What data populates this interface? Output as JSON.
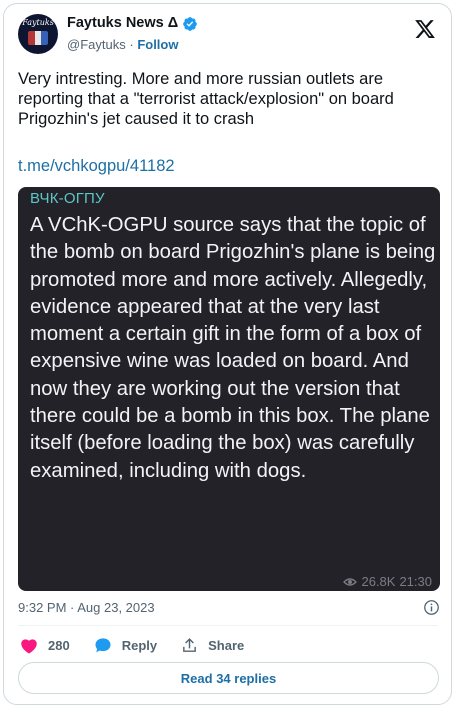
{
  "author": {
    "display_name": "Faytuks News Δ",
    "handle": "@Faytuks",
    "separator": "·",
    "follow_label": "Follow",
    "avatar_text": "Faytuks",
    "verified_icon": "verified-badge-icon"
  },
  "tweet": {
    "text": "Very intresting. More and more russian outlets are reporting that a \"terrorist attack/explosion\" on board Prigozhin's jet caused it to crash",
    "link": "t.me/vchkogpu/41182",
    "timestamp": "9:32 PM · Aug 23, 2023"
  },
  "embed": {
    "channel": "ВЧК-ОГПУ",
    "body": "A VChK-OGPU source says that the topic of the bomb on board Prigozhin's plane is being promoted more and more actively. Allegedly, evidence appeared that at the very last moment a certain gift in the form of a box of expensive wine was loaded on board. And now they are working out the version that there could be a bomb in this box. The plane itself (before loading the box) was carefully examined, including with dogs.",
    "views": "26.8K",
    "time": "21:30",
    "background": "#232228",
    "channel_color": "#5cc6c9"
  },
  "actions": {
    "likes": "280",
    "reply_label": "Reply",
    "share_label": "Share",
    "read_replies_label": "Read 34 replies"
  },
  "colors": {
    "accent": "#1d6fa5",
    "like": "#f91880",
    "verified": "#1d9bf0",
    "muted": "#536471"
  }
}
